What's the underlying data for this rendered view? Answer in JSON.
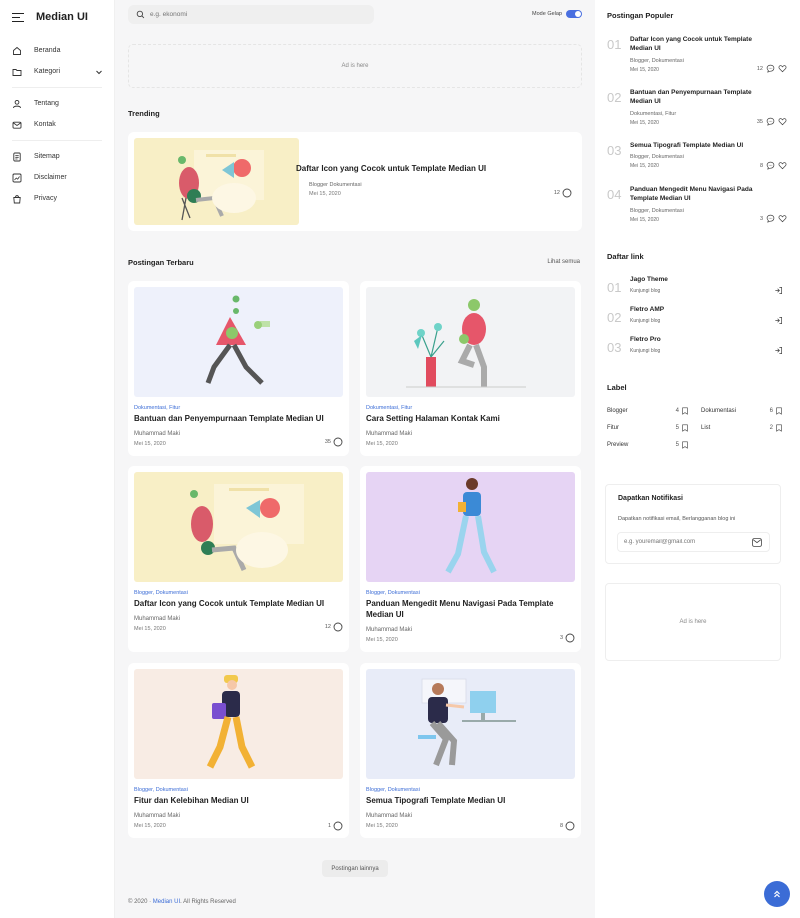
{
  "brand": {
    "title": "Median UI"
  },
  "nav": {
    "items": [
      {
        "label": "Beranda"
      },
      {
        "label": "Kategori"
      },
      {
        "label": "Tentang"
      },
      {
        "label": "Kontak"
      },
      {
        "label": "Sitemap"
      },
      {
        "label": "Disclaimer"
      },
      {
        "label": "Privacy"
      }
    ]
  },
  "topbar": {
    "search_placeholder": "e.g. ekonomi",
    "dark_mode_label": "Mode Gelap"
  },
  "ads": {
    "top": "Ad is here",
    "side": "Ad is here"
  },
  "trending": {
    "section_title": "Trending",
    "title": "Daftar Icon yang Cocok untuk Template Median UI",
    "category": "Blogger Dokumentasi",
    "date": "Mei 15, 2020",
    "comments": "12"
  },
  "latest": {
    "section_title": "Postingan Terbaru",
    "see_all": "Lihat semua",
    "posts": [
      {
        "category": "Dokumentasi, Fitur",
        "title": "Bantuan dan Penyempurnaan Template Median UI",
        "author": "Muhammad Maki",
        "date": "Mei 15, 2020",
        "comments": "35"
      },
      {
        "category": "Dokumentasi, Fitur",
        "title": "Cara Setting Halaman Kontak Kami",
        "author": "Muhammad Maki",
        "date": "Mei 15, 2020",
        "comments": ""
      },
      {
        "category": "Blogger, Dokumentasi",
        "title": "Daftar Icon yang Cocok untuk Template Median UI",
        "author": "Muhammad Maki",
        "date": "Mei 15, 2020",
        "comments": "12"
      },
      {
        "category": "Blogger, Dokumentasi",
        "title": "Panduan Mengedit Menu Navigasi Pada Template Median UI",
        "author": "Muhammad Maki",
        "date": "Mei 15, 2020",
        "comments": "3"
      },
      {
        "category": "Blogger, Dokumentasi",
        "title": "Fitur dan Kelebihan Median UI",
        "author": "Muhammad Maki",
        "date": "Mei 15, 2020",
        "comments": "1"
      },
      {
        "category": "Blogger, Dokumentasi",
        "title": "Semua Tipografi Template Median UI",
        "author": "Muhammad Maki",
        "date": "Mei 15, 2020",
        "comments": "8"
      }
    ],
    "more_button": "Postingan lainnya"
  },
  "footer": {
    "prefix": "© 2020 · ",
    "brand": "Median UI",
    "suffix": ". All Rights Reserved"
  },
  "popular": {
    "section_title": "Postingan Populer",
    "items": [
      {
        "num": "01",
        "title": "Daftar Icon yang Cocok untuk Template Median UI",
        "category": "Blogger, Dokumentasi",
        "date": "Mei 15, 2020",
        "comments": "12"
      },
      {
        "num": "02",
        "title": "Bantuan dan Penyempurnaan Template Median UI",
        "category": "Dokumentasi, Fitur",
        "date": "Mei 15, 2020",
        "comments": "35"
      },
      {
        "num": "03",
        "title": "Semua Tipografi Template Median UI",
        "category": "Blogger, Dokumentasi",
        "date": "Mei 15, 2020",
        "comments": "8"
      },
      {
        "num": "04",
        "title": "Panduan Mengedit Menu Navigasi Pada Template Median UI",
        "category": "Blogger, Dokumentasi",
        "date": "Mei 15, 2020",
        "comments": "3"
      }
    ]
  },
  "links": {
    "section_title": "Daftar link",
    "items": [
      {
        "num": "01",
        "name": "Jago Theme",
        "sub": "Kunjungi blog"
      },
      {
        "num": "02",
        "name": "Fletro AMP",
        "sub": "Kunjungi blog"
      },
      {
        "num": "03",
        "name": "Fletro Pro",
        "sub": "Kunjungi blog"
      }
    ]
  },
  "labels": {
    "section_title": "Label",
    "items": [
      {
        "name": "Blogger",
        "count": "4"
      },
      {
        "name": "Dokumentasi",
        "count": "6"
      },
      {
        "name": "Fitur",
        "count": "5"
      },
      {
        "name": "List",
        "count": "2"
      },
      {
        "name": "Preview",
        "count": "5"
      }
    ]
  },
  "notification": {
    "title": "Dapatkan Notifikasi",
    "text": "Dapatkan notifikasi email, Berlangganan blog ini",
    "placeholder": "e.g. youremail@gmail.com"
  },
  "colors": {
    "accent": "#3b6cd6",
    "toggle": "#4a6fe0"
  }
}
